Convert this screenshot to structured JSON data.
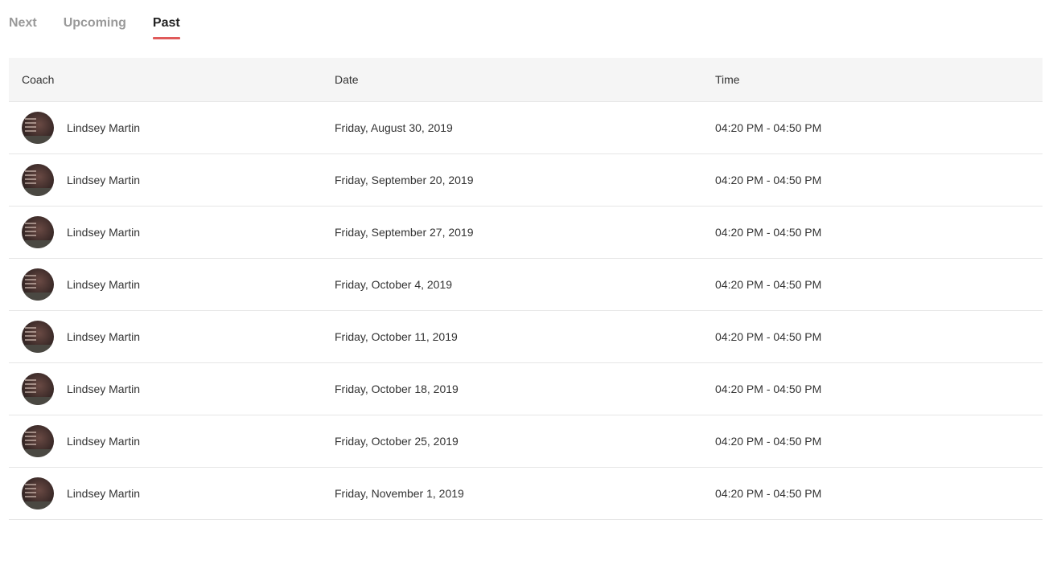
{
  "tabs": [
    {
      "label": "Next",
      "active": false
    },
    {
      "label": "Upcoming",
      "active": false
    },
    {
      "label": "Past",
      "active": true
    }
  ],
  "accent_color": "#e05a5a",
  "table": {
    "headers": {
      "coach": "Coach",
      "date": "Date",
      "time": "Time"
    },
    "rows": [
      {
        "coach": "Lindsey Martin",
        "date": "Friday, August 30, 2019",
        "time": "04:20 PM - 04:50 PM"
      },
      {
        "coach": "Lindsey Martin",
        "date": "Friday, September 20, 2019",
        "time": "04:20 PM - 04:50 PM"
      },
      {
        "coach": "Lindsey Martin",
        "date": "Friday, September 27, 2019",
        "time": "04:20 PM - 04:50 PM"
      },
      {
        "coach": "Lindsey Martin",
        "date": "Friday, October 4, 2019",
        "time": "04:20 PM - 04:50 PM"
      },
      {
        "coach": "Lindsey Martin",
        "date": "Friday, October 11, 2019",
        "time": "04:20 PM - 04:50 PM"
      },
      {
        "coach": "Lindsey Martin",
        "date": "Friday, October 18, 2019",
        "time": "04:20 PM - 04:50 PM"
      },
      {
        "coach": "Lindsey Martin",
        "date": "Friday, October 25, 2019",
        "time": "04:20 PM - 04:50 PM"
      },
      {
        "coach": "Lindsey Martin",
        "date": "Friday, November 1, 2019",
        "time": "04:20 PM - 04:50 PM"
      }
    ]
  }
}
